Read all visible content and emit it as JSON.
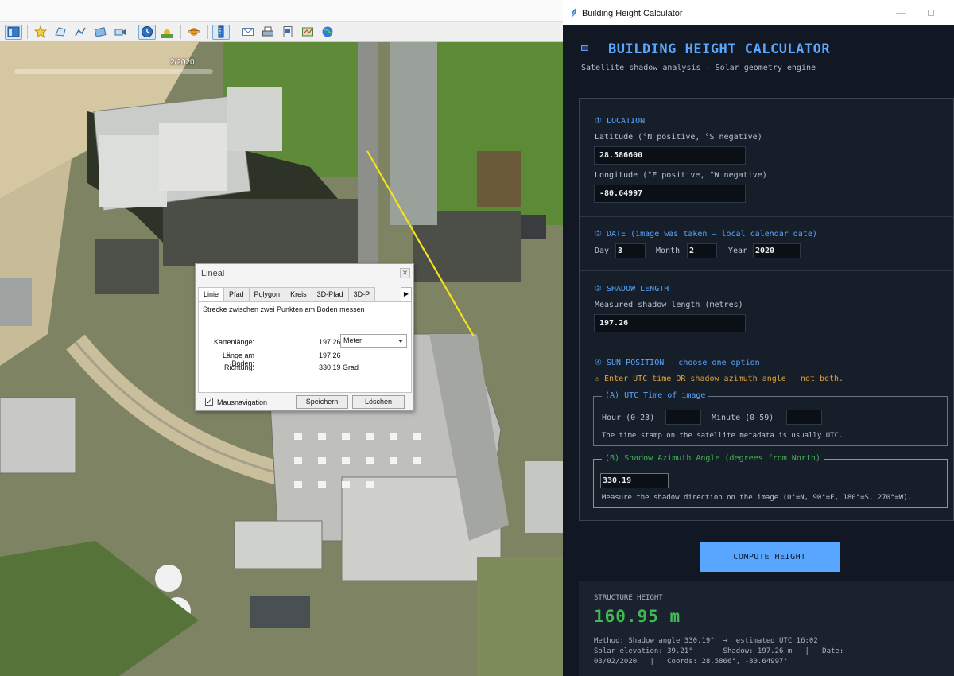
{
  "earth": {
    "time_slider_label": "2/2020",
    "toolbar_icons": [
      "sidebar-icon",
      "placemark-icon",
      "polygon-icon",
      "path-icon",
      "image-overlay-icon",
      "tour-icon",
      "history-icon",
      "sunlight-icon",
      "planets-icon",
      "ruler-icon",
      "email-icon",
      "print-icon",
      "save-image-icon",
      "map-view-icon",
      "earth-icon"
    ]
  },
  "lineal": {
    "title": "Lineal",
    "tabs": [
      "Linie",
      "Pfad",
      "Polygon",
      "Kreis",
      "3D-Pfad",
      "3D-P"
    ],
    "instruction": "Strecke zwischen zwei Punkten am Boden messen",
    "map_length_label": "Kartenlänge:",
    "map_length_value": "197,26",
    "unit": "Meter",
    "ground_length_label": "Länge am Boden:",
    "ground_length_value": "197,26",
    "heading_label": "Richtung:",
    "heading_value": "330,19 Grad",
    "mouse_nav_label": "Mausnavigation",
    "save_button": "Speichern",
    "delete_button": "Löschen"
  },
  "calc": {
    "window_title": "Building Height Calculator",
    "title": "BUILDING HEIGHT CALCULATOR",
    "subtitle": "Satellite shadow analysis  ·  Solar geometry engine",
    "location": {
      "head": "① LOCATION",
      "lat_label": "Latitude  (°N positive, °S negative)",
      "lat_value": "28.586600",
      "lon_label": "Longitude  (°E positive, °W negative)",
      "lon_value": "-80.64997"
    },
    "date": {
      "head": "② DATE  (image was taken — local calendar date)",
      "day_label": "Day",
      "day_value": "3",
      "month_label": "Month",
      "month_value": "2",
      "year_label": "Year",
      "year_value": "2020"
    },
    "shadow": {
      "head": "③ SHADOW LENGTH",
      "label": "Measured shadow length  (metres)",
      "value": "197.26"
    },
    "sun": {
      "head": "④ SUN POSITION  — choose one option",
      "warning": "⚠  Enter UTC time  OR  shadow azimuth angle — not both.",
      "utc_legend": "(A)  UTC Time of image",
      "hour_label": "Hour (0–23)",
      "hour_value": "",
      "minute_label": "Minute (0–59)",
      "minute_value": "",
      "utc_note": "The time stamp on the satellite metadata is usually UTC.",
      "azimuth_legend": "(B)  Shadow Azimuth Angle (degrees from North)",
      "azimuth_value": "330.19",
      "azimuth_note": "Measure the shadow direction on the image (0°=N, 90°=E, 180°=S, 270°=W)."
    },
    "compute_button": "COMPUTE HEIGHT",
    "result": {
      "label": "STRUCTURE HEIGHT",
      "value": "160.95  m",
      "details": "Method: Shadow angle 330.19°  →  estimated UTC 16:02\nSolar elevation: 39.21°   |   Shadow: 197.26 m   |   Date:\n03/02/2020   |   Coords: 28.5866°, -80.64997°"
    }
  },
  "colors": {
    "accent_blue": "#58a6ff",
    "success_green": "#3fb950",
    "warning_amber": "#e3a23a",
    "measure_line": "#f5e21b"
  }
}
